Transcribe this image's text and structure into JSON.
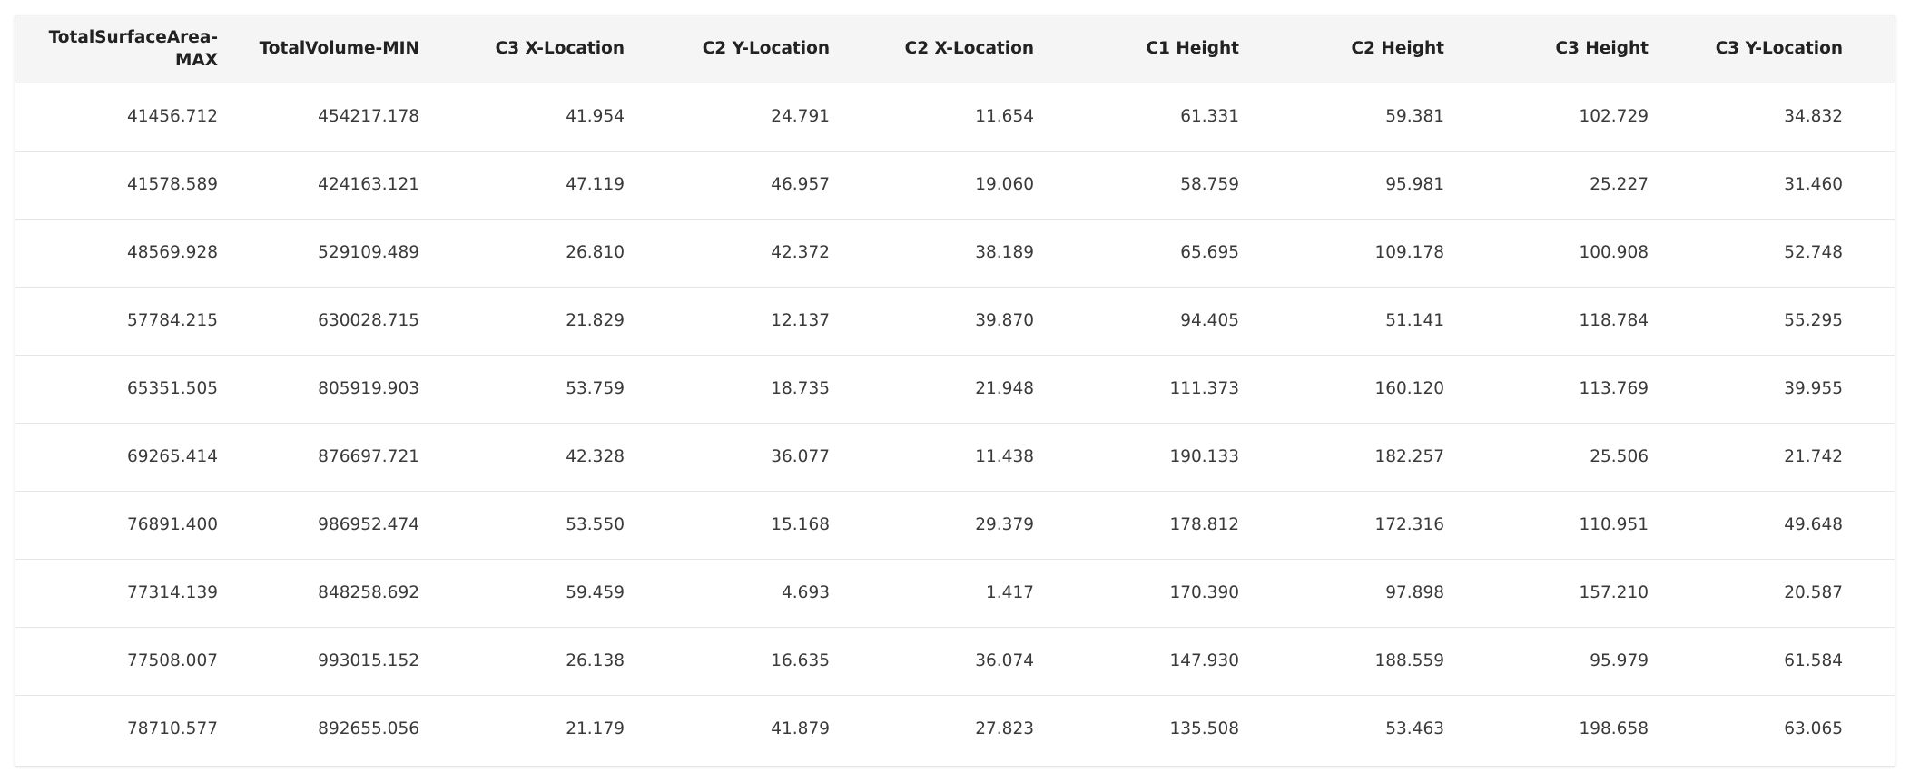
{
  "table": {
    "columns": [
      "TotalSurfaceArea-MAX",
      "TotalVolume-MIN",
      "C3 X-Location",
      "C2 Y-Location",
      "C2 X-Location",
      "C1 Height",
      "C2 Height",
      "C3 Height",
      "C3 Y-Location"
    ],
    "rows": [
      [
        "41456.712",
        "454217.178",
        "41.954",
        "24.791",
        "11.654",
        "61.331",
        "59.381",
        "102.729",
        "34.832"
      ],
      [
        "41578.589",
        "424163.121",
        "47.119",
        "46.957",
        "19.060",
        "58.759",
        "95.981",
        "25.227",
        "31.460"
      ],
      [
        "48569.928",
        "529109.489",
        "26.810",
        "42.372",
        "38.189",
        "65.695",
        "109.178",
        "100.908",
        "52.748"
      ],
      [
        "57784.215",
        "630028.715",
        "21.829",
        "12.137",
        "39.870",
        "94.405",
        "51.141",
        "118.784",
        "55.295"
      ],
      [
        "65351.505",
        "805919.903",
        "53.759",
        "18.735",
        "21.948",
        "111.373",
        "160.120",
        "113.769",
        "39.955"
      ],
      [
        "69265.414",
        "876697.721",
        "42.328",
        "36.077",
        "11.438",
        "190.133",
        "182.257",
        "25.506",
        "21.742"
      ],
      [
        "76891.400",
        "986952.474",
        "53.550",
        "15.168",
        "29.379",
        "178.812",
        "172.316",
        "110.951",
        "49.648"
      ],
      [
        "77314.139",
        "848258.692",
        "59.459",
        "4.693",
        "1.417",
        "170.390",
        "97.898",
        "157.210",
        "20.587"
      ],
      [
        "77508.007",
        "993015.152",
        "26.138",
        "16.635",
        "36.074",
        "147.930",
        "188.559",
        "95.979",
        "61.584"
      ],
      [
        "78710.577",
        "892655.056",
        "21.179",
        "41.879",
        "27.823",
        "135.508",
        "53.463",
        "198.658",
        "63.065"
      ]
    ]
  },
  "colors": {
    "header_bg": "#f5f5f5",
    "border": "#e6e6e6",
    "header_text": "#222222",
    "cell_text": "#3a3a3a"
  }
}
